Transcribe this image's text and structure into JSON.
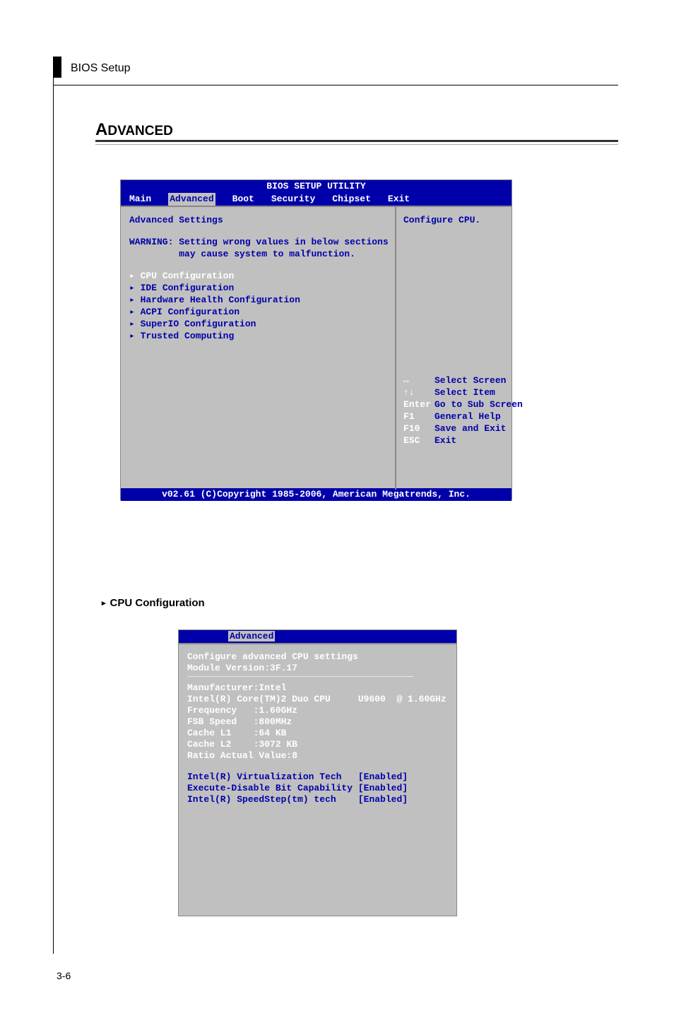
{
  "header": {
    "label": "BIOS Setup"
  },
  "section": {
    "first_letter": "A",
    "rest": "DVANCED"
  },
  "bios1": {
    "title": "BIOS SETUP UTILITY",
    "tabs": {
      "main": "Main",
      "advanced": "Advanced",
      "boot": "Boot",
      "security": "Security",
      "chipset": "Chipset",
      "exit": "Exit"
    },
    "left": {
      "heading": "Advanced Settings",
      "warning_l1": "WARNING: Setting wrong values in below sections",
      "warning_l2": "         may cause system to malfunction.",
      "items": {
        "cpu": "▸ CPU Configuration",
        "ide": "▸ IDE Configuration",
        "hw": "▸ Hardware Health Configuration",
        "acpi": "▸ ACPI Configuration",
        "superio": "▸ SuperIO Configuration",
        "trusted": "▸ Trusted Computing"
      }
    },
    "right": {
      "help": "Configure CPU.",
      "hints": {
        "lr_key": "↔",
        "lr_txt": "Select Screen",
        "ud_key": "↑↓",
        "ud_txt": "Select Item",
        "ent_key": "Enter",
        "ent_txt": "Go to Sub Screen",
        "f1_key": "F1",
        "f1_txt": "General Help",
        "f10_key": "F10",
        "f10_txt": "Save and Exit",
        "esc_key": "ESC",
        "esc_txt": "Exit"
      }
    },
    "footer": "v02.61 (C)Copyright 1985-2006, American Megatrends, Inc."
  },
  "subsection": {
    "marker": "▸",
    "label": "CPU Configuration"
  },
  "bios2": {
    "tab": "Advanced",
    "heading": "Configure advanced CPU settings",
    "module": "Module Version:3F.17",
    "info": {
      "mfr": "Manufacturer:Intel",
      "cpu": "Intel(R) Core(TM)2 Duo CPU     U9600  @ 1.60GHz",
      "freq": "Frequency   :1.60GHz",
      "fsb": "FSB Speed   :800MHz",
      "l1": "Cache L1    :64 KB",
      "l2": "Cache L2    :3072 KB",
      "ratio": "Ratio Actual Value:8"
    },
    "settings": {
      "vt": "Intel(R) Virtualization Tech   [Enabled]",
      "xd": "Execute-Disable Bit Capability [Enabled]",
      "ss": "Intel(R) SpeedStep(tm) tech    [Enabled]"
    }
  },
  "page_number": "3-6"
}
